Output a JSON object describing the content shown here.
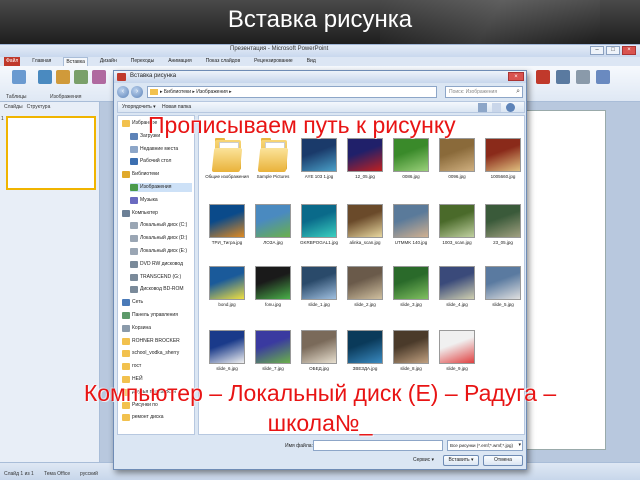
{
  "slide": {
    "title": "Вставка рисунка",
    "hint_top": "Прописываем путь к рисунку",
    "hint_bottom_line1": "Компьютер – Локальный диск (E) – Радуга –",
    "hint_bottom_line2": "школа№_"
  },
  "app": {
    "title": "Презентация - Microsoft PowerPoint",
    "window_buttons": [
      "–",
      "□",
      "×"
    ],
    "tabs": [
      {
        "label": "Файл",
        "state": "file"
      },
      {
        "label": "Главная",
        "state": ""
      },
      {
        "label": "Вставка",
        "state": "active"
      },
      {
        "label": "Дизайн",
        "state": ""
      },
      {
        "label": "Переходы",
        "state": ""
      },
      {
        "label": "Анимация",
        "state": ""
      },
      {
        "label": "Показ слайдов",
        "state": ""
      },
      {
        "label": "Рецензирование",
        "state": ""
      },
      {
        "label": "Вид",
        "state": ""
      }
    ],
    "ribbon_groups": [
      "Таблицы",
      "Изображения"
    ],
    "pane_tabs": [
      "Слайды",
      "Структура"
    ],
    "slide_number": "1",
    "status": {
      "slide_info": "Слайд 1 из 1",
      "theme": "Тема Office",
      "language": "русский"
    }
  },
  "dialog": {
    "title": "Вставка рисунка",
    "close": "×",
    "address": "▸ Библиотеки ▸ Изображения ▸",
    "search_placeholder": "Поиск: Изображения",
    "toolbar": {
      "organize": "Упорядочить ▾",
      "new_folder": "Новая папка"
    },
    "nav": [
      {
        "label": "Избранное",
        "indent": false,
        "color": "#f2c14e",
        "sel": false
      },
      {
        "label": "Загрузки",
        "indent": true,
        "color": "#5d83b8",
        "sel": false
      },
      {
        "label": "Недавние места",
        "indent": true,
        "color": "#8da6c8",
        "sel": false
      },
      {
        "label": "Рабочий стол",
        "indent": true,
        "color": "#3c6fb0",
        "sel": false
      },
      {
        "label": "Библиотеки",
        "indent": false,
        "color": "#e0a92b",
        "sel": false
      },
      {
        "label": "Изображения",
        "indent": true,
        "color": "#4a9a4a",
        "sel": true
      },
      {
        "label": "Музыка",
        "indent": true,
        "color": "#6a6ac0",
        "sel": false
      },
      {
        "label": "Компьютер",
        "indent": false,
        "color": "#6c8096",
        "sel": false
      },
      {
        "label": "Локальный диск (C:)",
        "indent": true,
        "color": "#9aa6b4",
        "sel": false
      },
      {
        "label": "Локальный диск (D:)",
        "indent": true,
        "color": "#9aa6b4",
        "sel": false
      },
      {
        "label": "Локальный диск (E:)",
        "indent": true,
        "color": "#9aa6b4",
        "sel": false
      },
      {
        "label": "DVD RW дисковод",
        "indent": true,
        "color": "#7a8a9a",
        "sel": false
      },
      {
        "label": "TRANSCEND (G:)",
        "indent": true,
        "color": "#7a8a9a",
        "sel": false
      },
      {
        "label": "Дисковод BD-ROM",
        "indent": true,
        "color": "#7a8a9a",
        "sel": false
      },
      {
        "label": "Сеть",
        "indent": false,
        "color": "#4a7ab8",
        "sel": false
      },
      {
        "label": "Панель управления",
        "indent": false,
        "color": "#5d9a6a",
        "sel": false
      },
      {
        "label": "Корзина",
        "indent": false,
        "color": "#8a9aaa",
        "sel": false
      },
      {
        "label": "ROHNER BROCKER",
        "indent": false,
        "color": "#f2c14e",
        "sel": false
      },
      {
        "label": "school_vodka_sherry",
        "indent": false,
        "color": "#f2c14e",
        "sel": false
      },
      {
        "label": "гост",
        "indent": false,
        "color": "#f2c14e",
        "sel": false
      },
      {
        "label": "НЕЙ",
        "indent": false,
        "color": "#f2c14e",
        "sel": false
      },
      {
        "label": "Друзья полезности",
        "indent": false,
        "color": "#f2c14e",
        "sel": false
      },
      {
        "label": "Рисунки по",
        "indent": false,
        "color": "#f2c14e",
        "sel": false
      },
      {
        "label": "ремонт диска",
        "indent": false,
        "color": "#f2c14e",
        "sel": false
      }
    ],
    "files": [
      {
        "name": "Общие изображения",
        "kind": "folder",
        "c1": "",
        "c2": ""
      },
      {
        "name": "Sample Pictures",
        "kind": "folder",
        "c1": "",
        "c2": ""
      },
      {
        "name": "AYE 103 1.jpg",
        "kind": "img",
        "c1": "#1a3a6a",
        "c2": "#4aa0c8"
      },
      {
        "name": "12_05.jpg",
        "kind": "img",
        "c1": "#20206a",
        "c2": "#c02020"
      },
      {
        "name": "0086.jpg",
        "kind": "img",
        "c1": "#3a8a2a",
        "c2": "#9ad07a"
      },
      {
        "name": "0096.jpg",
        "kind": "img",
        "c1": "#8a6a3a",
        "c2": "#d0b080"
      },
      {
        "name": "1005660.jpg",
        "kind": "img",
        "c1": "#8a2a1a",
        "c2": "#e0c080"
      },
      {
        "name": "ТРИ_Тигра.jpg",
        "kind": "img",
        "c1": "#0a4a8a",
        "c2": "#e08a20"
      },
      {
        "name": "ЛОЗА.jpg",
        "kind": "img",
        "c1": "#4a8ac0",
        "c2": "#6ab04a"
      },
      {
        "name": "GKRBPOGAL1.jpg",
        "kind": "img",
        "c1": "#0a6a8a",
        "c2": "#3ad0c0"
      },
      {
        "name": "alinka_scan.jpg",
        "kind": "img",
        "c1": "#6a4a2a",
        "c2": "#e8d8a0"
      },
      {
        "name": "UTMMK 140.jpg",
        "kind": "img",
        "c1": "#5a7a9a",
        "c2": "#d0b090"
      },
      {
        "name": "1003_scan.jpg",
        "kind": "img",
        "c1": "#4a6a2a",
        "c2": "#c0d0a0"
      },
      {
        "name": "23_05.jpg",
        "kind": "img",
        "c1": "#3a5a3a",
        "c2": "#a0a080"
      },
      {
        "name": "bond.jpg",
        "kind": "img",
        "c1": "#1a5a9a",
        "c2": "#f0e040"
      },
      {
        "name": "fonu.jpg",
        "kind": "img",
        "c1": "#1a1a1a",
        "c2": "#4ab04a"
      },
      {
        "name": "slide_1.jpg",
        "kind": "img",
        "c1": "#2a4a6a",
        "c2": "#a0c0e0"
      },
      {
        "name": "slide_2.jpg",
        "kind": "img",
        "c1": "#6a5a4a",
        "c2": "#d0c0a0"
      },
      {
        "name": "slide_3.jpg",
        "kind": "img",
        "c1": "#2a6a2a",
        "c2": "#80c060"
      },
      {
        "name": "slide_4.jpg",
        "kind": "img",
        "c1": "#3a4a7a",
        "c2": "#d0d0b0"
      },
      {
        "name": "slide_5.jpg",
        "kind": "img",
        "c1": "#5a7aa0",
        "c2": "#e0e0e0"
      },
      {
        "name": "slide_6.jpg",
        "kind": "img",
        "c1": "#1a3a8a",
        "c2": "#f0f0f0"
      },
      {
        "name": "slide_7.jpg",
        "kind": "img",
        "c1": "#3a3aa0",
        "c2": "#6ab04a"
      },
      {
        "name": "ОБЕД.jpg",
        "kind": "img",
        "c1": "#7a6a5a",
        "c2": "#e8e0d0"
      },
      {
        "name": "ЗВЕЗДА.jpg",
        "kind": "img",
        "c1": "#0a3a5a",
        "c2": "#3a8ac0"
      },
      {
        "name": "slide_8.jpg",
        "kind": "img",
        "c1": "#4a3a2a",
        "c2": "#c0a080"
      },
      {
        "name": "slide_9.jpg",
        "kind": "img",
        "c1": "#f0f0f0",
        "c2": "#e04040"
      }
    ],
    "filename_label": "Имя файла:",
    "filetype": "Все рисунки (*.emf;*.wmf;*.jpg)",
    "service": "Сервис ▾",
    "insert": "Вставить ▾",
    "cancel": "Отмена"
  },
  "colors": {
    "accent_red": "#e81414",
    "selection": "#cde1f7",
    "file_tab": "#c0392b"
  }
}
